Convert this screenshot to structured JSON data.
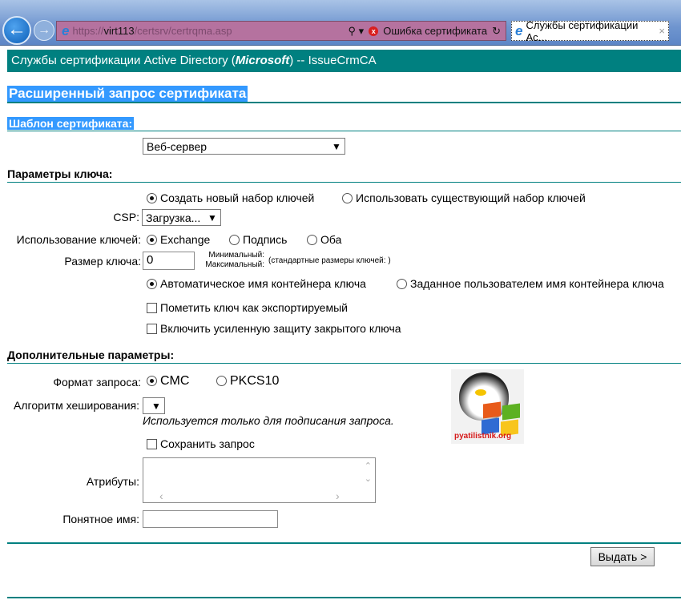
{
  "browser": {
    "url_scheme": "https://",
    "url_host": "virt113",
    "url_path": "/certsrv/certrqma.asp",
    "cert_error": "Ошибка сертификата",
    "tab_title": "Службы сертификации Ac...",
    "tab_close": "×",
    "ie_logo": "e"
  },
  "header": {
    "prefix": "Службы сертификации Active Directory (",
    "brand": "Microsoft",
    "suffix": ")  --  IssueCrmCA"
  },
  "page_title": "Расширенный запрос сертификата",
  "template": {
    "heading": "Шаблон сертификата:",
    "selected": "Веб-сервер"
  },
  "key_params": {
    "heading": "Параметры ключа:",
    "keyset_new": "Создать новый набор ключей",
    "keyset_existing": "Использовать существующий набор ключей",
    "csp_label": "CSP:",
    "csp_value": "Загрузка...",
    "usage_label": "Использование ключей:",
    "usage_exchange": "Exchange",
    "usage_signature": "Подпись",
    "usage_both": "Оба",
    "size_label": "Размер ключа:",
    "size_value": "0",
    "min_label": "Минимальный:",
    "max_label": "Максимальный:",
    "std_sizes": "(стандартные размеры ключей: )",
    "container_auto": "Автоматическое имя контейнера ключа",
    "container_user": "Заданное пользователем имя контейнера ключа",
    "exportable": "Пометить ключ как экспортируемый",
    "strong_protection": "Включить усиленную защиту закрытого ключа"
  },
  "additional": {
    "heading": "Дополнительные параметры:",
    "format_label": "Формат запроса:",
    "format_cmc": "CMC",
    "format_pkcs10": "PKCS10",
    "hash_label": "Алгоритм хеширования:",
    "hash_note": "Используется только для подписания запроса.",
    "save_request": "Сохранить запрос",
    "attributes_label": "Атрибуты:",
    "friendly_name_label": "Понятное имя:"
  },
  "watermark": "pyatilistnik.org",
  "submit_label": "Выдать >"
}
